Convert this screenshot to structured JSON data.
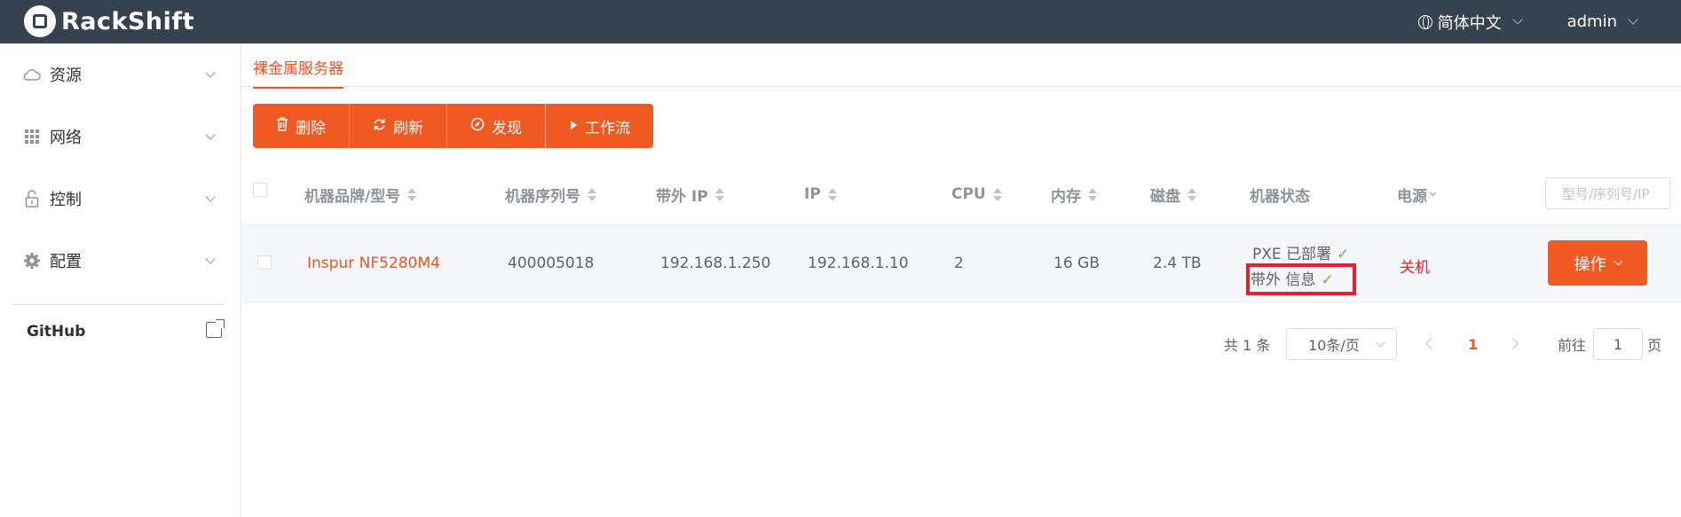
{
  "header": {
    "app_name": "RackShift",
    "language": "简体中文",
    "user": "admin"
  },
  "sidebar": {
    "items": [
      {
        "label": "资源",
        "icon": "cloud-icon"
      },
      {
        "label": "网络",
        "icon": "grid-icon"
      },
      {
        "label": "控制",
        "icon": "lock-icon"
      },
      {
        "label": "配置",
        "icon": "gear-icon"
      }
    ],
    "github": "GitHub"
  },
  "tabs": {
    "active": "裸金属服务器"
  },
  "toolbar": {
    "delete": "删除",
    "refresh": "刷新",
    "discover": "发现",
    "workflow": "工作流"
  },
  "table": {
    "headers": {
      "brand": "机器品牌/型号",
      "serial": "机器序列号",
      "oob_ip": "带外 IP",
      "ip": "IP",
      "cpu": "CPU",
      "memory": "内存",
      "disk": "磁盘",
      "status": "机器状态",
      "power": "电源"
    },
    "search_placeholder": "型号/序列号/IP",
    "rows": [
      {
        "brand": "Inspur NF5280M4",
        "serial": "400005018",
        "oob_ip": "192.168.1.250",
        "ip": "192.168.1.10",
        "cpu": "2",
        "memory": "16 GB",
        "disk": "2.4 TB",
        "status_pxe": "PXE 已部署",
        "status_oob": "带外 信息",
        "power": "关机",
        "action": "操作"
      }
    ]
  },
  "pagination": {
    "total": "共 1 条",
    "page_size": "10条/页",
    "current_page": "1",
    "goto_label": "前往",
    "goto_value": "1",
    "page_suffix": "页"
  },
  "colors": {
    "header_bg": "#364250",
    "accent": "#f05a22",
    "danger": "#e8202c",
    "success": "#67c23a"
  }
}
